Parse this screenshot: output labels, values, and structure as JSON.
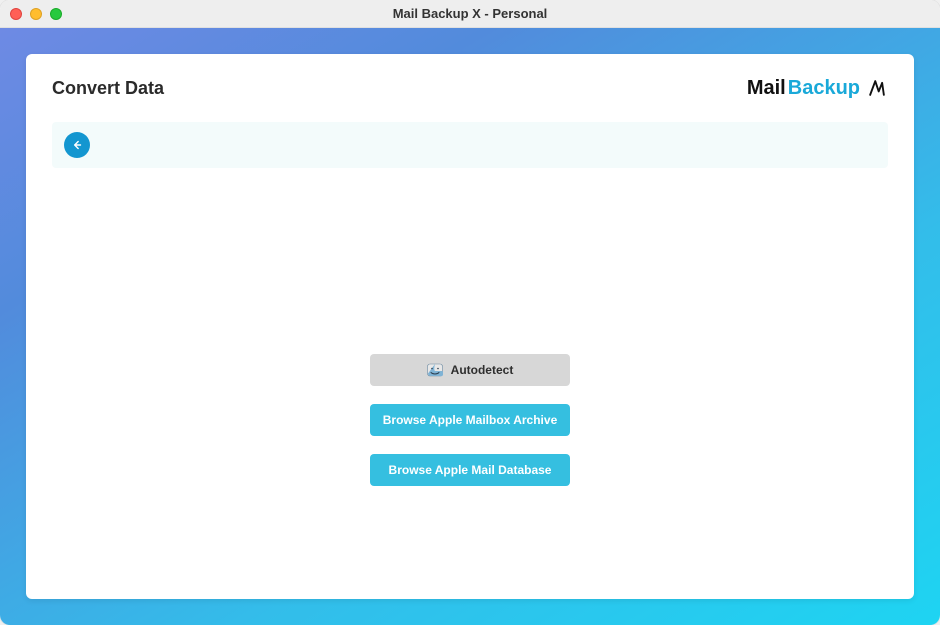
{
  "window": {
    "title": "Mail Backup X - Personal"
  },
  "header": {
    "page_title": "Convert Data",
    "logo_part1": "Mail",
    "logo_part2": "Backup"
  },
  "actions": {
    "autodetect": "Autodetect",
    "browse_archive": "Browse Apple Mailbox Archive",
    "browse_database": "Browse Apple Mail Database"
  },
  "colors": {
    "accent_blue": "#35bfe0",
    "back_circle": "#1396d0",
    "gradient_start": "#6e8ae4",
    "gradient_end": "#1ed4f2"
  }
}
